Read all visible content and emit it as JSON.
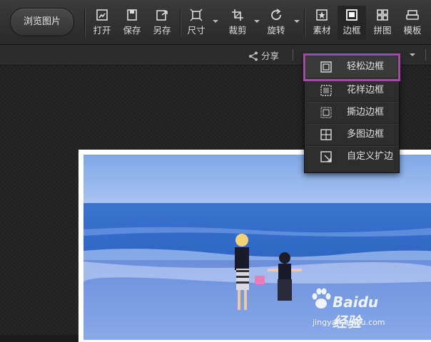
{
  "toolbar": {
    "browse_label": "浏览图片",
    "tools": [
      {
        "label": "打开",
        "icon": "open-icon"
      },
      {
        "label": "保存",
        "icon": "save-icon"
      },
      {
        "label": "另存",
        "icon": "save-as-icon"
      },
      {
        "label": "尺寸",
        "icon": "resize-icon",
        "dropdown": true
      },
      {
        "label": "裁剪",
        "icon": "crop-icon",
        "dropdown": true
      },
      {
        "label": "旋转",
        "icon": "rotate-icon",
        "dropdown": true
      },
      {
        "label": "素材",
        "icon": "material-icon"
      },
      {
        "label": "边框",
        "icon": "border-icon",
        "active": true
      },
      {
        "label": "拼图",
        "icon": "collage-icon"
      },
      {
        "label": "模板",
        "icon": "template-icon"
      }
    ]
  },
  "subbar": {
    "share_label": "分享"
  },
  "border_menu": {
    "items": [
      {
        "label": "轻松边框",
        "icon": "simple-border-icon",
        "highlighted": true
      },
      {
        "label": "花样边框",
        "icon": "pattern-border-icon"
      },
      {
        "label": "撕边边框",
        "icon": "torn-border-icon"
      },
      {
        "label": "多图边框",
        "icon": "multi-border-icon"
      },
      {
        "label": "自定义扩边",
        "icon": "custom-expand-icon"
      }
    ],
    "highlight_color": "#a24aa8"
  },
  "watermark": {
    "title": "Baidu经验",
    "subtitle": "jingyan.baidu.com"
  },
  "colors": {
    "toolbar_bg": "#333333",
    "canvas_bg": "#202020",
    "highlight": "#a24aa8"
  }
}
